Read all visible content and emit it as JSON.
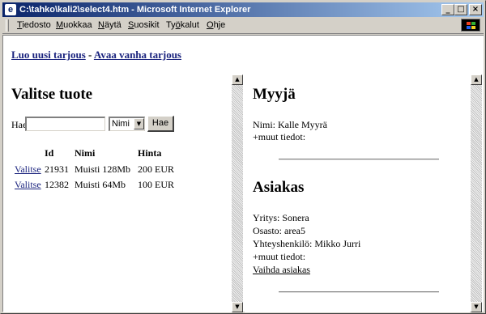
{
  "window": {
    "title": "C:\\tahko\\kali2\\select4.htm - Microsoft Internet Explorer"
  },
  "menu": {
    "items": [
      {
        "mnemonic": "T",
        "rest": "iedosto"
      },
      {
        "mnemonic": "M",
        "rest": "uokkaa"
      },
      {
        "mnemonic": "N",
        "rest": "äytä"
      },
      {
        "mnemonic": "S",
        "rest": "uosikit"
      },
      {
        "pre": "Ty",
        "mnemonic": "ö",
        "rest": "kalut"
      },
      {
        "mnemonic": "O",
        "rest": "hje"
      }
    ]
  },
  "top_links": {
    "new_offer": "Luo uusi tarjous",
    "separator": "-",
    "open_offer": "Avaa vanha tarjous"
  },
  "product": {
    "heading": "Valitse tuote",
    "search_label": "Hae",
    "search_value": "",
    "select_value": "Nimi",
    "search_button": "Hae",
    "columns": [
      "Id",
      "Nimi",
      "Hinta"
    ],
    "rows": [
      {
        "action": "Valitse",
        "id": "21931",
        "name": "Muisti 128Mb",
        "price": "200 EUR"
      },
      {
        "action": "Valitse",
        "id": "12382",
        "name": "Muisti 64Mb",
        "price": "100 EUR"
      }
    ]
  },
  "seller": {
    "heading": "Myyjä",
    "name_line": "Nimi: Kalle Myyrä",
    "more": "+muut tiedot:"
  },
  "customer": {
    "heading": "Asiakas",
    "company": "Yritys: Sonera",
    "department": "Osasto: area5",
    "contact": "Yhteyshenkilö: Mikko Jurri",
    "more": "+muut tiedot:",
    "change_link": "Vaihda asiakas"
  }
}
